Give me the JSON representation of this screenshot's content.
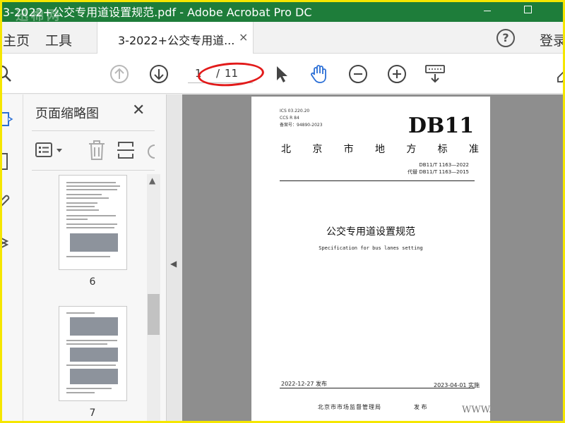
{
  "window": {
    "title": "3-2022+公交专用道设置规范.pdf - Adobe Acrobat Pro DC",
    "watermark": "迅棉网"
  },
  "tabs": {
    "home": "主页",
    "tools": "工具",
    "document": "3-2022+公交专用道...",
    "close": "×",
    "help": "?",
    "login": "登录"
  },
  "toolbar": {
    "current_page": "1",
    "separator": "/",
    "total_pages": "11"
  },
  "thumbnail_panel": {
    "heading": "页面缩略图",
    "close": "✕",
    "thumbnails": [
      {
        "number": "6"
      },
      {
        "number": "7"
      }
    ]
  },
  "document": {
    "ics": "ICS 03.220.20",
    "ccs": "CCS R 84",
    "record_no": "备案号：94890-2023",
    "db_code": "DB11",
    "standard_type_chars": [
      "北",
      "京",
      "市",
      "地",
      "方",
      "标",
      "准"
    ],
    "std_code": "DB11/T 1163—2022",
    "replaces": "代替 DB11/T 1163—2015",
    "title_cn": "公交专用道设置规范",
    "title_en": "Specification for bus lanes setting",
    "publish_date": "2022-12-27 发布",
    "implement_date": "2023-04-01 实施",
    "issuer": "北京市市场监督管理局",
    "issue": "发 布"
  },
  "overlay": {
    "www": "WWW."
  },
  "colors": {
    "titlebar": "#1e7d3a",
    "frame": "#f5e600",
    "annotation": "#e21a1a",
    "nav_blue": "#2b6fd6"
  }
}
